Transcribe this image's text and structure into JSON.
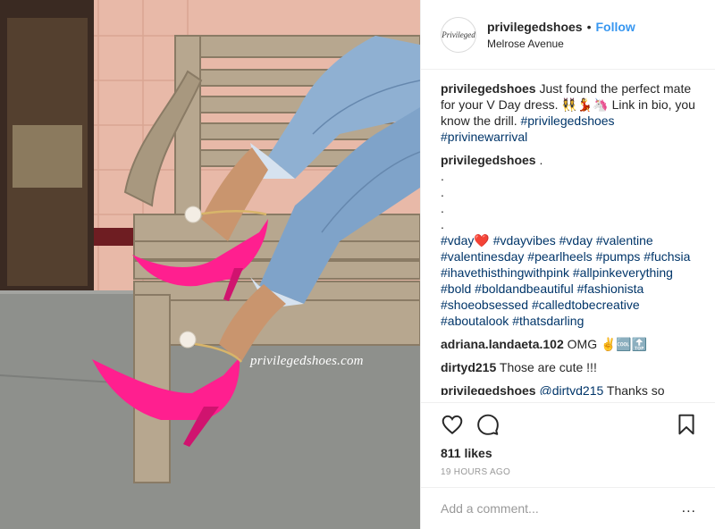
{
  "post": {
    "watermark": "privilegedshoes.com"
  },
  "header": {
    "avatar_text": "Privileged",
    "username": "privilegedshoes",
    "separator": "•",
    "follow_label": "Follow",
    "location": "Melrose Avenue"
  },
  "comments": {
    "caption": {
      "user": "privilegedshoes",
      "text": " Just found the perfect mate for your V Day dress. 👯‍♀️💃🦄 Link in bio, you know the drill. ",
      "tag1": "#privilegedshoes",
      "tag2": "#privinewarrival"
    },
    "second": {
      "user": "privilegedshoes",
      "text": " .",
      "dots": [
        ".",
        ".",
        ".",
        "."
      ],
      "tags": [
        "#vday❤️",
        "#vdayvibes",
        "#vday",
        "#valentine",
        "#valentinesday",
        "#pearlheels",
        "#pumps",
        "#fuchsia",
        "#ihavethisthingwithpink",
        "#allpinkeverything",
        "#bold",
        "#boldandbeautiful",
        "#fashionista",
        "#shoeobsessed",
        "#calledtobecreative",
        "#aboutalook",
        "#thatsdarling"
      ]
    },
    "c3": {
      "user": "adriana.landaeta.102",
      "text": " OMG ✌️🆒🔝"
    },
    "c4": {
      "user": "dirtyd215",
      "text": " Those are cute !!!"
    },
    "c5": {
      "user": "privilegedshoes",
      "mention": "@dirtyd215",
      "text": " Thanks so"
    }
  },
  "actions": {
    "likes": "811 likes",
    "time": "19 HOURS AGO"
  },
  "add_comment": {
    "placeholder": "Add a comment...",
    "more": "..."
  },
  "colors": {
    "accent": "#3897f0",
    "hashtag": "#003569",
    "shoe": "#ff1f8f"
  },
  "icons": [
    "heart-icon",
    "comment-icon",
    "bookmark-icon",
    "more-icon"
  ]
}
